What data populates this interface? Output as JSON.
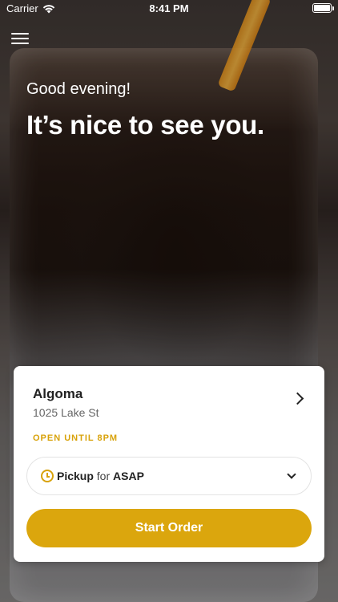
{
  "status_bar": {
    "carrier": "Carrier",
    "time": "8:41 PM",
    "wifi_icon": "wifi-icon",
    "battery_icon": "battery-icon"
  },
  "header": {
    "menu_icon": "hamburger-menu-icon"
  },
  "greeting": {
    "salutation": "Good evening!",
    "headline": "It’s nice to see you."
  },
  "store_card": {
    "store_name": "Algoma",
    "address": "1025 Lake St",
    "hours_status": "OPEN UNTIL 8PM",
    "chevron_icon": "chevron-right-icon",
    "pickup": {
      "mode": "Pickup",
      "connector": "for",
      "time": "ASAP",
      "clock_icon": "clock-icon",
      "dropdown_icon": "chevron-down-icon"
    },
    "start_button_label": "Start Order"
  },
  "colors": {
    "accent": "#dba60d",
    "status_text": "#d8a20a",
    "card_bg": "#ffffff"
  }
}
